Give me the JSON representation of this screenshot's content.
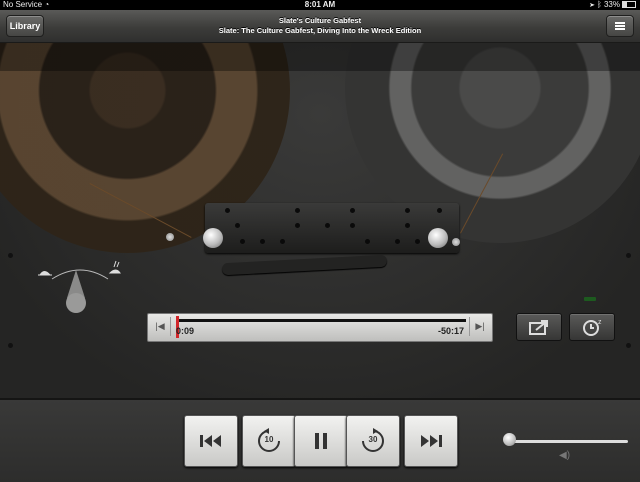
{
  "status_bar": {
    "carrier": "No Service",
    "time": "8:01 AM",
    "battery": "33%"
  },
  "nav": {
    "library_label": "Library",
    "podcast_title": "Slate's Culture Gabfest",
    "episode_title": "Slate: The Culture Gabfest, Diving Into the Wreck Edition",
    "list_icon": "list-icon"
  },
  "scrubber": {
    "elapsed": "0:09",
    "remaining": "-50:17",
    "position_fraction": 0.003
  },
  "controls": {
    "skip_back_seconds": "10",
    "skip_forward_seconds": "30",
    "icons": [
      "rewind-icon",
      "skip-back-10-icon",
      "pause-icon",
      "skip-forward-30-icon",
      "fast-forward-icon"
    ]
  },
  "volume": {
    "level_fraction": 0.02,
    "icon": "speaker-icon"
  },
  "speed": {
    "slow_icon": "turtle-icon",
    "fast_icon": "rabbit-icon"
  },
  "colors": {
    "playhead": "#d2262a",
    "accent_led": "#1d5a1f"
  }
}
